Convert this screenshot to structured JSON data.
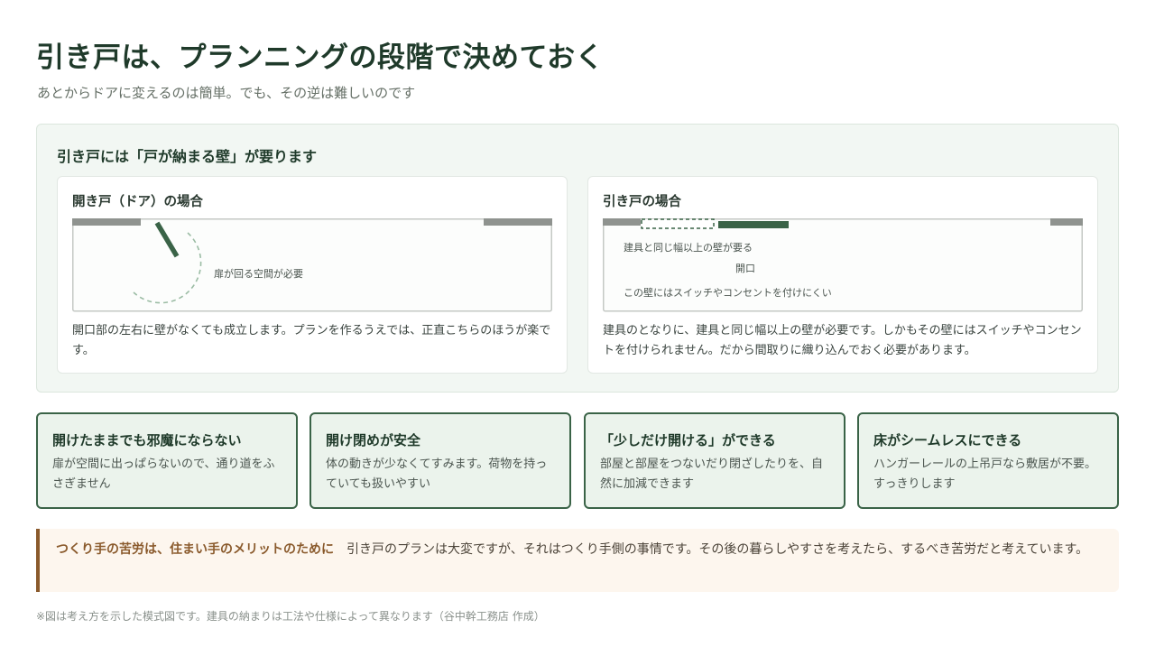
{
  "header": {
    "title": "引き戸は、プランニングの段階で決めておく",
    "subtitle": "あとからドアに変えるのは簡単。でも、その逆は難しいのです"
  },
  "comparison": {
    "title": "引き戸には「戸が納まる壁」が要ります",
    "door": {
      "title": "開き戸（ドア）の場合",
      "diagram_label": "扉が回る空間が必要",
      "description": "開口部の左右に壁がなくても成立します。プランを作るうえでは、正直こちらのほうが楽です。"
    },
    "sliding": {
      "title": "引き戸の場合",
      "label_wall": "建具と同じ幅以上の壁が要る",
      "label_opening": "開口",
      "label_outlet": "この壁にはスイッチやコンセントを付けにくい",
      "description": "建具のとなりに、建具と同じ幅以上の壁が必要です。しかもその壁にはスイッチやコンセントを付けられません。だから間取りに織り込んでおく必要があります。"
    }
  },
  "features": [
    {
      "title": "開けたままでも邪魔にならない",
      "description": "扉が空間に出っぱらないので、通り道をふさぎません"
    },
    {
      "title": "開け閉めが安全",
      "description": "体の動きが少なくてすみます。荷物を持っていても扱いやすい"
    },
    {
      "title": "「少しだけ開ける」ができる",
      "description": "部屋と部屋をつないだり閉ざしたりを、自然に加減できます"
    },
    {
      "title": "床がシームレスにできる",
      "description": "ハンガーレールの上吊戸なら敷居が不要。すっきりします"
    }
  ],
  "note": {
    "emphasis": "つくり手の苦労は、住まい手のメリットのために",
    "body": "引き戸のプランは大変ですが、それはつくり手側の事情です。その後の暮らしやすさを考えたら、するべき苦労だと考えています。"
  },
  "footnote": "※図は考え方を示した模式図です。建具の納まりは工法や仕様によって異なります（谷中幹工務店 作成）",
  "colors": {
    "accent": "#3a6347",
    "accent_dark": "#1f3a2a",
    "panel_bg": "#f2f7f3",
    "feature_bg": "#ebf3ec",
    "note_accent": "#8a5a2c",
    "wall_gray": "#8f938f"
  }
}
